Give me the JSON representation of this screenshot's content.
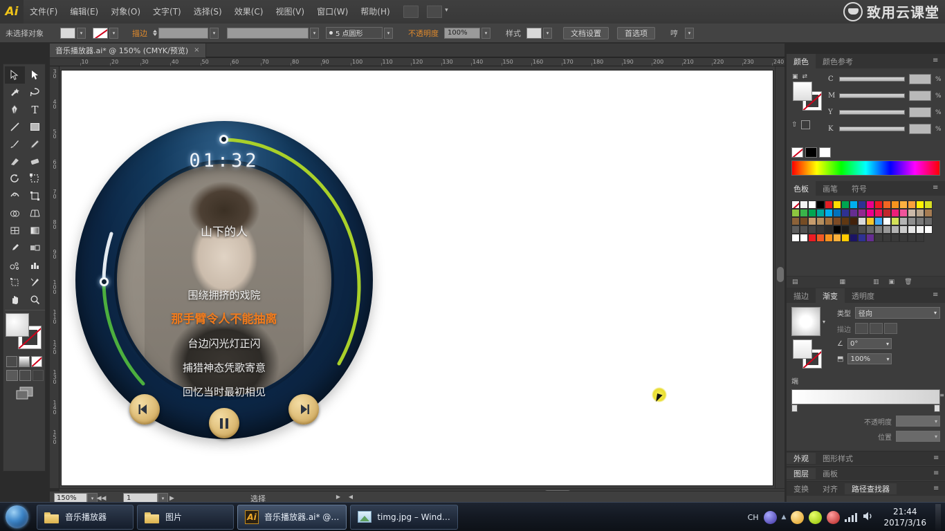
{
  "app": {
    "name": "Adobe Illustrator",
    "logo_text": "Ai",
    "watermark": "致用云课堂"
  },
  "menubar": {
    "items": [
      {
        "label": "文件(F)"
      },
      {
        "label": "编辑(E)"
      },
      {
        "label": "对象(O)"
      },
      {
        "label": "文字(T)"
      },
      {
        "label": "选择(S)"
      },
      {
        "label": "效果(C)"
      },
      {
        "label": "视图(V)"
      },
      {
        "label": "窗口(W)"
      },
      {
        "label": "帮助(H)"
      }
    ],
    "bridge_icon": "bridge-icon",
    "arrange_icon": "arrange-documents-icon"
  },
  "controlbar": {
    "selection_status": "未选择对象",
    "stroke_label": "描边",
    "stroke_weight": "",
    "profile": "5 点圆形",
    "opacity_label": "不透明度",
    "opacity_value": "100%",
    "style_label": "样式",
    "document_setup": "文档设置",
    "preferences": "首选项",
    "extra_label": "哼"
  },
  "document_tab": {
    "title": "音乐播放器.ai* @ 150% (CMYK/预览)",
    "close": "×"
  },
  "toolbar": {
    "tools": [
      {
        "name": "selection-tool",
        "selected": true
      },
      {
        "name": "direct-selection-tool",
        "selected": false
      },
      {
        "name": "magic-wand-tool",
        "selected": false
      },
      {
        "name": "lasso-tool",
        "selected": false
      },
      {
        "name": "pen-tool",
        "selected": false
      },
      {
        "name": "type-tool",
        "selected": false
      },
      {
        "name": "line-segment-tool",
        "selected": false
      },
      {
        "name": "rectangle-tool",
        "selected": false
      },
      {
        "name": "paintbrush-tool",
        "selected": false
      },
      {
        "name": "pencil-tool",
        "selected": false
      },
      {
        "name": "blob-brush-tool",
        "selected": false
      },
      {
        "name": "eraser-tool",
        "selected": false
      },
      {
        "name": "rotate-tool",
        "selected": false
      },
      {
        "name": "scale-tool",
        "selected": false
      },
      {
        "name": "width-tool",
        "selected": false
      },
      {
        "name": "free-transform-tool",
        "selected": false
      },
      {
        "name": "shape-builder-tool",
        "selected": false
      },
      {
        "name": "perspective-grid-tool",
        "selected": false
      },
      {
        "name": "mesh-tool",
        "selected": false
      },
      {
        "name": "gradient-tool",
        "selected": false
      },
      {
        "name": "eyedropper-tool",
        "selected": false
      },
      {
        "name": "blend-tool",
        "selected": false
      },
      {
        "name": "symbol-sprayer-tool",
        "selected": false
      },
      {
        "name": "column-graph-tool",
        "selected": false
      },
      {
        "name": "artboard-tool",
        "selected": false
      },
      {
        "name": "slice-tool",
        "selected": false
      },
      {
        "name": "hand-tool",
        "selected": false
      },
      {
        "name": "zoom-tool",
        "selected": false
      }
    ],
    "fill_color": "#ffffff",
    "stroke_color": "#ffffff",
    "stroke_none": true
  },
  "rulers": {
    "horizontal_ticks": [
      "10",
      "20",
      "30",
      "40",
      "50",
      "60",
      "70",
      "80",
      "90",
      "100",
      "110",
      "120",
      "130",
      "140",
      "150",
      "160",
      "170",
      "180",
      "190",
      "200",
      "210",
      "220",
      "230",
      "240"
    ],
    "vertical_ticks": [
      "30",
      "40",
      "50",
      "60",
      "70",
      "80",
      "90",
      "100",
      "110",
      "120",
      "130",
      "140",
      "150"
    ],
    "unit_step": 10
  },
  "artwork": {
    "name": "music-player-mockup",
    "timer": "01:32",
    "song_title": "山下的人",
    "lyrics": [
      {
        "text": "围绕拥挤的戏院",
        "active": false
      },
      {
        "text": "那手臂令人不能抽离",
        "active": true
      },
      {
        "text": "台边闪光灯正闪",
        "active": false
      },
      {
        "text": "捕猎神态凭歌寄意",
        "active": false
      },
      {
        "text": "回忆当时最初相见",
        "active": false
      }
    ],
    "buttons": [
      {
        "name": "previous-track-button",
        "icon": "previous-icon"
      },
      {
        "name": "pause-button",
        "icon": "pause-icon"
      },
      {
        "name": "next-track-button",
        "icon": "next-icon"
      }
    ],
    "progress_arc_color": "#a9d02a",
    "volume_arc_color": "#4caf3e",
    "ring_color_dark": "#0a1f38",
    "ring_color_light": "#2d5d86",
    "accent_orange": "#f07b1d"
  },
  "statusbar": {
    "zoom": "150%",
    "page": "1",
    "mode": "选择"
  },
  "panels": {
    "color": {
      "tabs": [
        {
          "label": "颜色",
          "active": true
        },
        {
          "label": "颜色参考",
          "active": false
        }
      ],
      "channels": [
        {
          "label": "C",
          "value": "",
          "unit": "%"
        },
        {
          "label": "M",
          "value": "",
          "unit": "%"
        },
        {
          "label": "Y",
          "value": "",
          "unit": "%"
        },
        {
          "label": "K",
          "value": "",
          "unit": "%"
        }
      ]
    },
    "swatches": {
      "tabs": [
        {
          "label": "色板",
          "active": true
        },
        {
          "label": "画笔",
          "active": false
        },
        {
          "label": "符号",
          "active": false
        }
      ],
      "colors": [
        "none",
        "#f2f2f2",
        "#ffffff",
        "#000000",
        "#e31e24",
        "#ffdd00",
        "#00a650",
        "#00aeef",
        "#2e3192",
        "#ec008c",
        "#ed1c24",
        "#f26522",
        "#f7941e",
        "#fbb040",
        "#f9a03c",
        "#fff200",
        "#d7df23",
        "#8dc63f",
        "#39b54a",
        "#00a651",
        "#00a99d",
        "#00aeef",
        "#0072bc",
        "#2e3192",
        "#662d91",
        "#92278f",
        "#ec008c",
        "#ed145b",
        "#c1272d",
        "#ed1e79",
        "#f0549b",
        "#cbb9a8",
        "#b9a58d",
        "#a67c52",
        "#8c6239",
        "#754c24",
        "#c69c6d",
        "#b58e5e",
        "#a3703c",
        "#7b4a24",
        "#603813",
        "#42210b",
        "#d9d9d9",
        "#f7c52b",
        "#3fa9f5",
        "#ffffff",
        "#d4e157",
        "#b4b4b4",
        "#8e8e8e",
        "#787878",
        "#6b6b6b",
        "#5e5e5e",
        "#525252",
        "#454545",
        "#383838",
        "#2b2b2b",
        "#000000",
        "#1a1a1a",
        "#333333",
        "#4d4d4d",
        "#666666",
        "#808080",
        "#999999",
        "#b3b3b3",
        "#cccccc",
        "#e6e6e6",
        "#f2f2f2",
        "#ffffff",
        "#ffffff",
        "#ffffff",
        "#ed1c24",
        "#f15a24",
        "#f7931e",
        "#fbb03b",
        "#ffcc00",
        "#1b1464",
        "#2e3192",
        "#662d91",
        "#3a3a3a",
        "#3a3a3a",
        "#3a3a3a",
        "#3a3a3a",
        "#3a3a3a",
        "#3a3a3a"
      ]
    },
    "gradient": {
      "tabs": [
        {
          "label": "描边",
          "active": false
        },
        {
          "label": "渐变",
          "active": true
        },
        {
          "label": "透明度",
          "active": false
        }
      ],
      "type_label": "类型",
      "type_value": "径向",
      "stroke_label": "描边",
      "angle_value": "0°",
      "scale_value": "100%",
      "edge_label": "端",
      "opacity_label": "不透明度",
      "opacity_value": "",
      "location_label": "位置",
      "location_value": ""
    },
    "appearance": {
      "tabs": [
        {
          "label": "外观",
          "active": true
        },
        {
          "label": "图形样式",
          "active": false
        }
      ]
    },
    "layers": {
      "tabs": [
        {
          "label": "图层",
          "active": true
        },
        {
          "label": "画板",
          "active": false
        }
      ]
    },
    "pathfinder": {
      "tabs": [
        {
          "label": "变换",
          "active": false
        },
        {
          "label": "对齐",
          "active": false
        },
        {
          "label": "路径查找器",
          "active": true
        }
      ]
    }
  },
  "taskbar": {
    "start_button": "start-button",
    "items": [
      {
        "label": "音乐播放器",
        "icon": "folder-icon",
        "active": false
      },
      {
        "label": "图片",
        "icon": "folder-icon",
        "active": false
      },
      {
        "label": "音乐播放器.ai* @…",
        "icon": "ai-icon",
        "active": true
      },
      {
        "label": "timg.jpg – Wind…",
        "icon": "image-icon",
        "active": false
      }
    ],
    "tray": {
      "ime": "CH",
      "icons": [
        "ime-icon",
        "browser-icon",
        "show-hidden-icon",
        "shield-icon",
        "update-icon",
        "antivirus-icon",
        "network-icon",
        "volume-icon"
      ],
      "time": "21:44",
      "date": "2017/3/16"
    }
  }
}
